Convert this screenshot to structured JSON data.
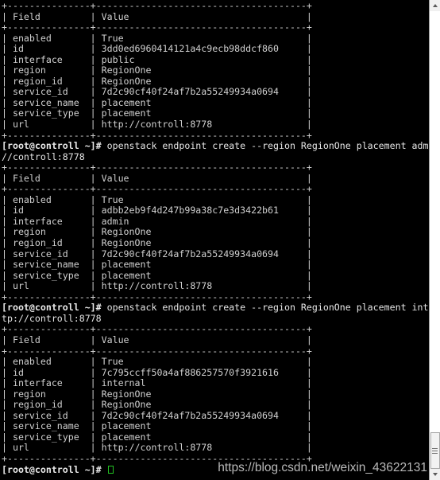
{
  "terminal": {
    "prompt": "[root@controll ~]#",
    "hostname": "controll",
    "user": "root",
    "cursor": "block-cursor",
    "colors": {
      "background": "#000000",
      "foreground": "#d8d8d8",
      "cursor": "#22c322",
      "border": "#cfcfcf"
    }
  },
  "watermark": {
    "text": "https://blog.csdn.net/weixin_43622131"
  },
  "scrollbar": {
    "up_arrow": "scroll-up-arrow",
    "down_arrow": "scroll-down-arrow",
    "thumb_position": "bottom"
  },
  "table_layout": {
    "rule": "+---------------+--------------------------------------+",
    "header_row": "| Field         | Value                                |",
    "fields": [
      "enabled",
      "id",
      "interface",
      "region",
      "region_id",
      "service_id",
      "service_name",
      "service_type",
      "url"
    ]
  },
  "blocks": [
    {
      "type": "table",
      "rows": [
        "+---------------+--------------------------------------+",
        "| Field         | Value                                |",
        "+---------------+--------------------------------------+",
        "| enabled       | True                                 |",
        "| id            | 3dd0ed6960414121a4c9ecb98ddcf860     |",
        "| interface     | public                               |",
        "| region        | RegionOne                            |",
        "| region_id     | RegionOne                            |",
        "| service_id    | 7d2c90cf40f24af7b2a55249934a0694     |",
        "| service_name  | placement                            |",
        "| service_type  | placement                            |",
        "| url           | http://controll:8778                 |",
        "+---------------+--------------------------------------+"
      ]
    },
    {
      "type": "command",
      "prompt": "[root@controll ~]# ",
      "lines": [
        "openstack endpoint create --region RegionOne placement admin http:",
        "//controll:8778"
      ]
    },
    {
      "type": "table",
      "rows": [
        "+---------------+--------------------------------------+",
        "| Field         | Value                                |",
        "+---------------+--------------------------------------+",
        "| enabled       | True                                 |",
        "| id            | adbb2eb9f4d247b99a38c7e3d3422b61     |",
        "| interface     | admin                                |",
        "| region        | RegionOne                            |",
        "| region_id     | RegionOne                            |",
        "| service_id    | 7d2c90cf40f24af7b2a55249934a0694     |",
        "| service_name  | placement                            |",
        "| service_type  | placement                            |",
        "| url           | http://controll:8778                 |",
        "+---------------+--------------------------------------+"
      ]
    },
    {
      "type": "command",
      "prompt": "[root@controll ~]# ",
      "lines": [
        "openstack endpoint create --region RegionOne placement internal ht",
        "tp://controll:8778"
      ]
    },
    {
      "type": "table",
      "rows": [
        "+---------------+--------------------------------------+",
        "| Field         | Value                                |",
        "+---------------+--------------------------------------+",
        "| enabled       | True                                 |",
        "| id            | 7c795ccff50a4af886257570f3921616     |",
        "| interface     | internal                             |",
        "| region        | RegionOne                            |",
        "| region_id     | RegionOne                            |",
        "| service_id    | 7d2c90cf40f24af7b2a55249934a0694     |",
        "| service_name  | placement                            |",
        "| service_type  | placement                            |",
        "| url           | http://controll:8778                 |",
        "+---------------+--------------------------------------+"
      ]
    },
    {
      "type": "prompt",
      "prompt": "[root@controll ~]# ",
      "cursor": true
    }
  ]
}
